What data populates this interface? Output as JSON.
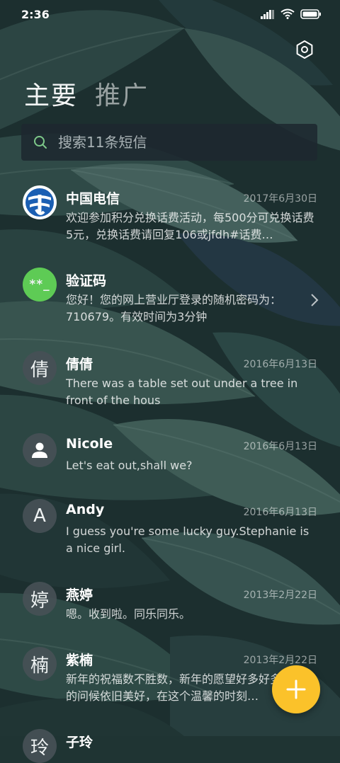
{
  "status_bar": {
    "time": "2:36"
  },
  "tabs": [
    {
      "label": "主要",
      "active": true
    },
    {
      "label": "推广",
      "active": false
    }
  ],
  "search": {
    "placeholder": "搜索11条短信"
  },
  "conversations": [
    {
      "name": "中国电信",
      "date": "2017年6月30日",
      "preview": "欢迎参加积分兑换话费活动，每500分可兑换话费5元，兑换话费请回复106或jfdh#话费…",
      "avatar": "china-telecom-logo"
    },
    {
      "name": "验证码",
      "date": "",
      "preview": "您好！您的网上营业厅登录的随机密码为：710679。有效时间为3分钟",
      "avatar_text": "**_"
    },
    {
      "name": "倩倩",
      "date": "2016年6月13日",
      "preview": "There was a table set out under a tree in front of the hous",
      "avatar_text": "倩"
    },
    {
      "name": "Nicole",
      "date": "2016年6月13日",
      "preview": "Let's eat out,shall we?",
      "avatar": "person-icon"
    },
    {
      "name": "Andy",
      "date": "2016年6月13日",
      "preview": "I guess you're some lucky guy.Stephanie is a nice girl.",
      "avatar_text": "A"
    },
    {
      "name": "燕婷",
      "date": "2013年2月22日",
      "preview": "嗯。收到啦。同乐同乐。",
      "avatar_text": "婷"
    },
    {
      "name": "紫楠",
      "date": "2013年2月22日",
      "preview": "新年的祝福数不胜数，新年的愿望好多好多，新年的问候依旧美好，在这个温馨的时刻…",
      "avatar_text": "楠"
    },
    {
      "name": "子玲",
      "date": "",
      "preview": "",
      "avatar_text": "玲"
    }
  ],
  "colors": {
    "fab": "#fbc22a",
    "search_bg": "#1e2830",
    "verify_avatar": "#5ecb55",
    "telecom_blue": "#1b5fb3"
  }
}
